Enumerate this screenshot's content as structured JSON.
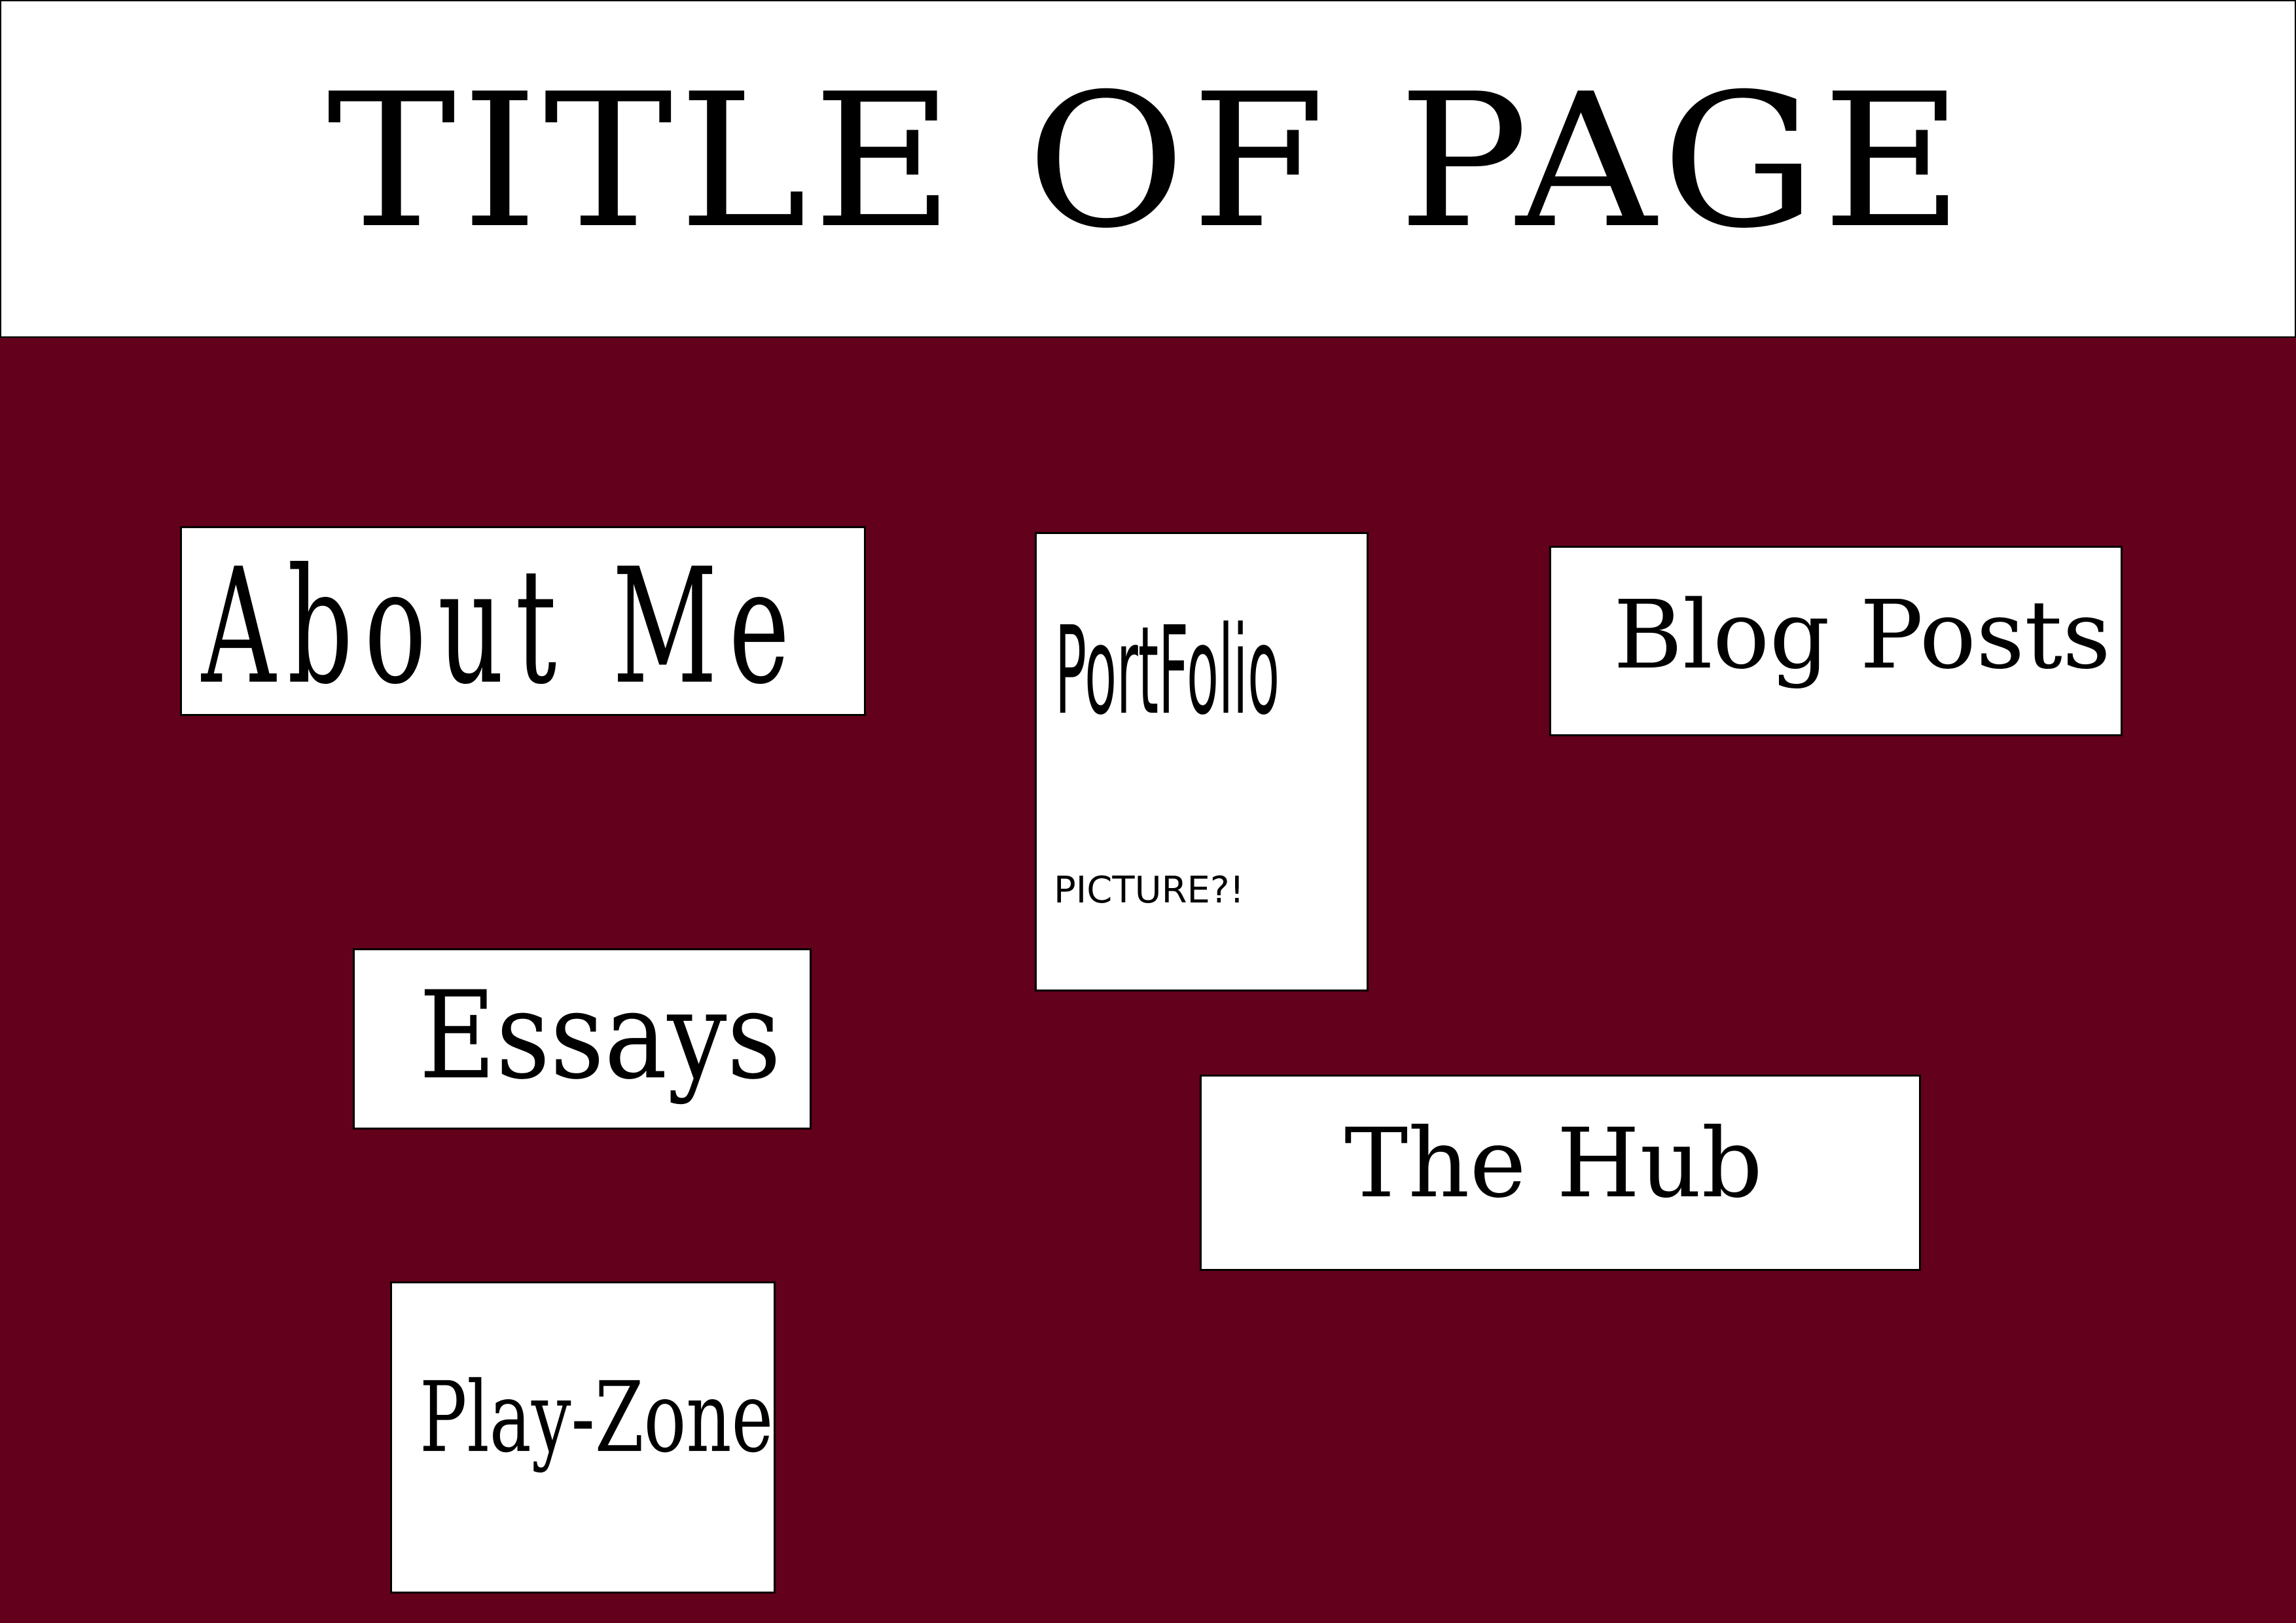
{
  "header": {
    "title": "TITLE OF PAGE"
  },
  "nav": {
    "about_me": "About Me",
    "portfolio": "PortFolio",
    "portfolio_note": "PICTURE?!",
    "blog_posts": "Blog Posts",
    "essays": "Essays",
    "the_hub": "The Hub",
    "play_zone": "Play-Zone"
  },
  "colors": {
    "background": "#63001b",
    "card": "#ffffff",
    "text": "#000000"
  }
}
